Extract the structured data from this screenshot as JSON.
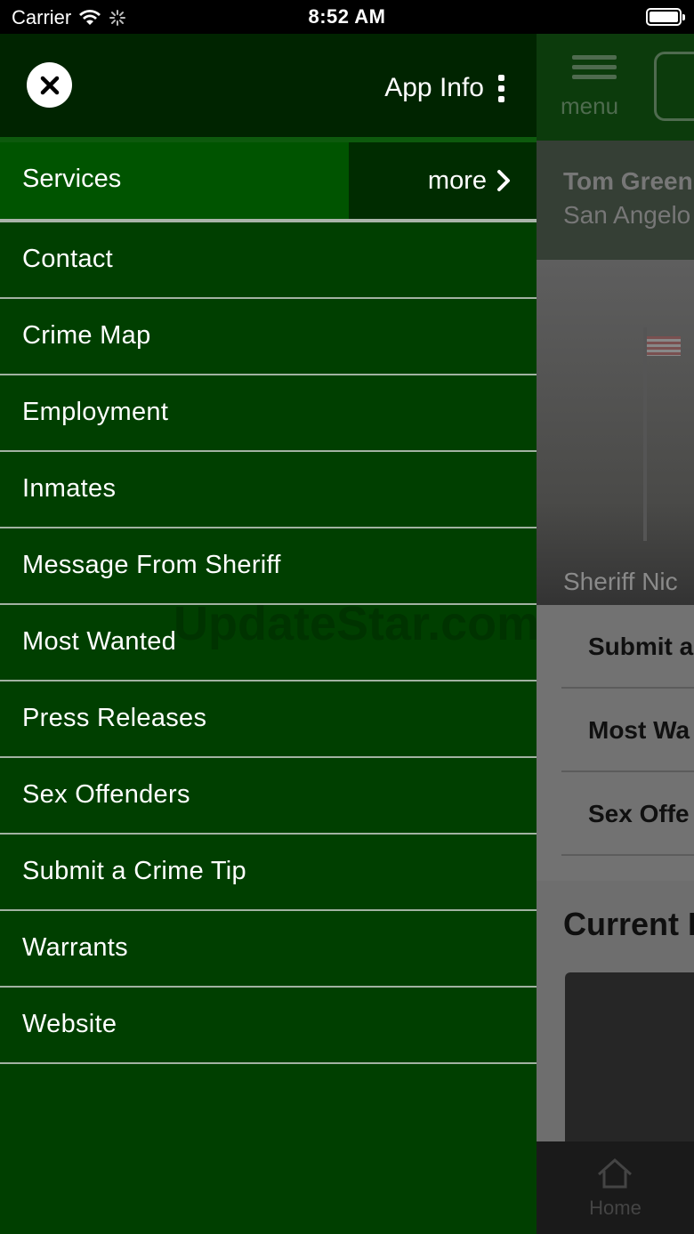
{
  "status_bar": {
    "carrier": "Carrier",
    "time": "8:52 AM"
  },
  "drawer": {
    "app_info_label": "App Info",
    "services_label": "Services",
    "more_label": "more",
    "items": [
      {
        "label": "Contact"
      },
      {
        "label": "Crime Map"
      },
      {
        "label": "Employment"
      },
      {
        "label": "Inmates"
      },
      {
        "label": "Message From Sheriff"
      },
      {
        "label": "Most Wanted"
      },
      {
        "label": "Press Releases"
      },
      {
        "label": "Sex Offenders"
      },
      {
        "label": "Submit a Crime Tip"
      },
      {
        "label": "Warrants"
      },
      {
        "label": "Website"
      }
    ]
  },
  "background": {
    "menu_label": "menu",
    "title_line1": "Tom Green",
    "title_line2": "San Angelo",
    "photo_caption": "Sheriff Nic",
    "quick_links": [
      "Submit a",
      "Most Wa",
      "Sex Offe"
    ],
    "current_heading": "Current I",
    "footer_home_label": "Home"
  },
  "watermark": "UpdateStar.com",
  "colors": {
    "drawer_bg": "#003f00",
    "header_bg": "#002400",
    "services_bg": "#005400",
    "more_bg": "#002c00",
    "separator": "#a2b2a2"
  }
}
